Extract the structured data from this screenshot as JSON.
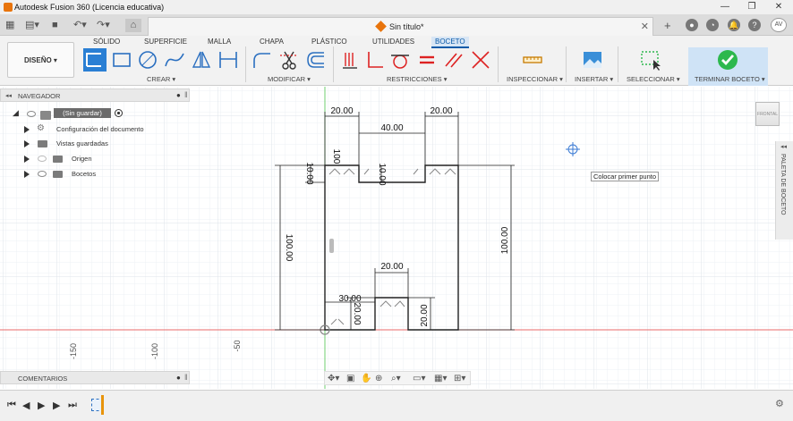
{
  "window": {
    "title": "Autodesk Fusion 360 (Licencia educativa)",
    "minimize": "—",
    "maximize": "❐",
    "close": "✕"
  },
  "document": {
    "name": "Sin título*",
    "close": "✕"
  },
  "user": {
    "initials": "AV"
  },
  "ribbon": {
    "tabs": [
      {
        "label": "SÓLIDO",
        "active": false
      },
      {
        "label": "SUPERFICIE",
        "active": false
      },
      {
        "label": "MALLA",
        "active": false
      },
      {
        "label": "CHAPA",
        "active": false
      },
      {
        "label": "PLÁSTICO",
        "active": false
      },
      {
        "label": "UTILIDADES",
        "active": false
      },
      {
        "label": "BOCETO",
        "active": true
      }
    ],
    "workspace": "DISEÑO ▾",
    "groups": {
      "create": "CREAR ▾",
      "modify": "MODIFICAR ▾",
      "constraints": "RESTRICCIONES ▾",
      "inspect": "INSPECCIONAR ▾",
      "insert": "INSERTAR ▾",
      "select": "SELECCIONAR ▾",
      "finish": "TERMINAR BOCETO ▾"
    },
    "accent": "#0a5aa8",
    "finish_color": "#2db84d"
  },
  "navigator": {
    "title": "NAVEGADOR",
    "root": "(Sin guardar)",
    "items": [
      {
        "label": "Configuración del documento"
      },
      {
        "label": "Vistas guardadas"
      },
      {
        "label": "Origen"
      },
      {
        "label": "Bocetos"
      }
    ]
  },
  "comments": {
    "title": "COMENTARIOS"
  },
  "canvas": {
    "tooltip": "Colocar primer punto",
    "viewcube": "FRONTAL",
    "side_panel": "PALETA DE BOCETO",
    "axis_labels": [
      "-150",
      "-100",
      "-50"
    ],
    "dimensions": {
      "top_left": "20.00",
      "top_middle": "40.00",
      "top_right": "20.00",
      "left_small": "10.00",
      "notch_depth": "10.00",
      "left_height": "100.00",
      "right_height": "100.00",
      "bottom_slot_width": "20.00",
      "bottom_left_offset": "30.00",
      "bottom_left_height": "20.00",
      "bottom_right_height": "20.00",
      "small_top_left": "100"
    }
  }
}
